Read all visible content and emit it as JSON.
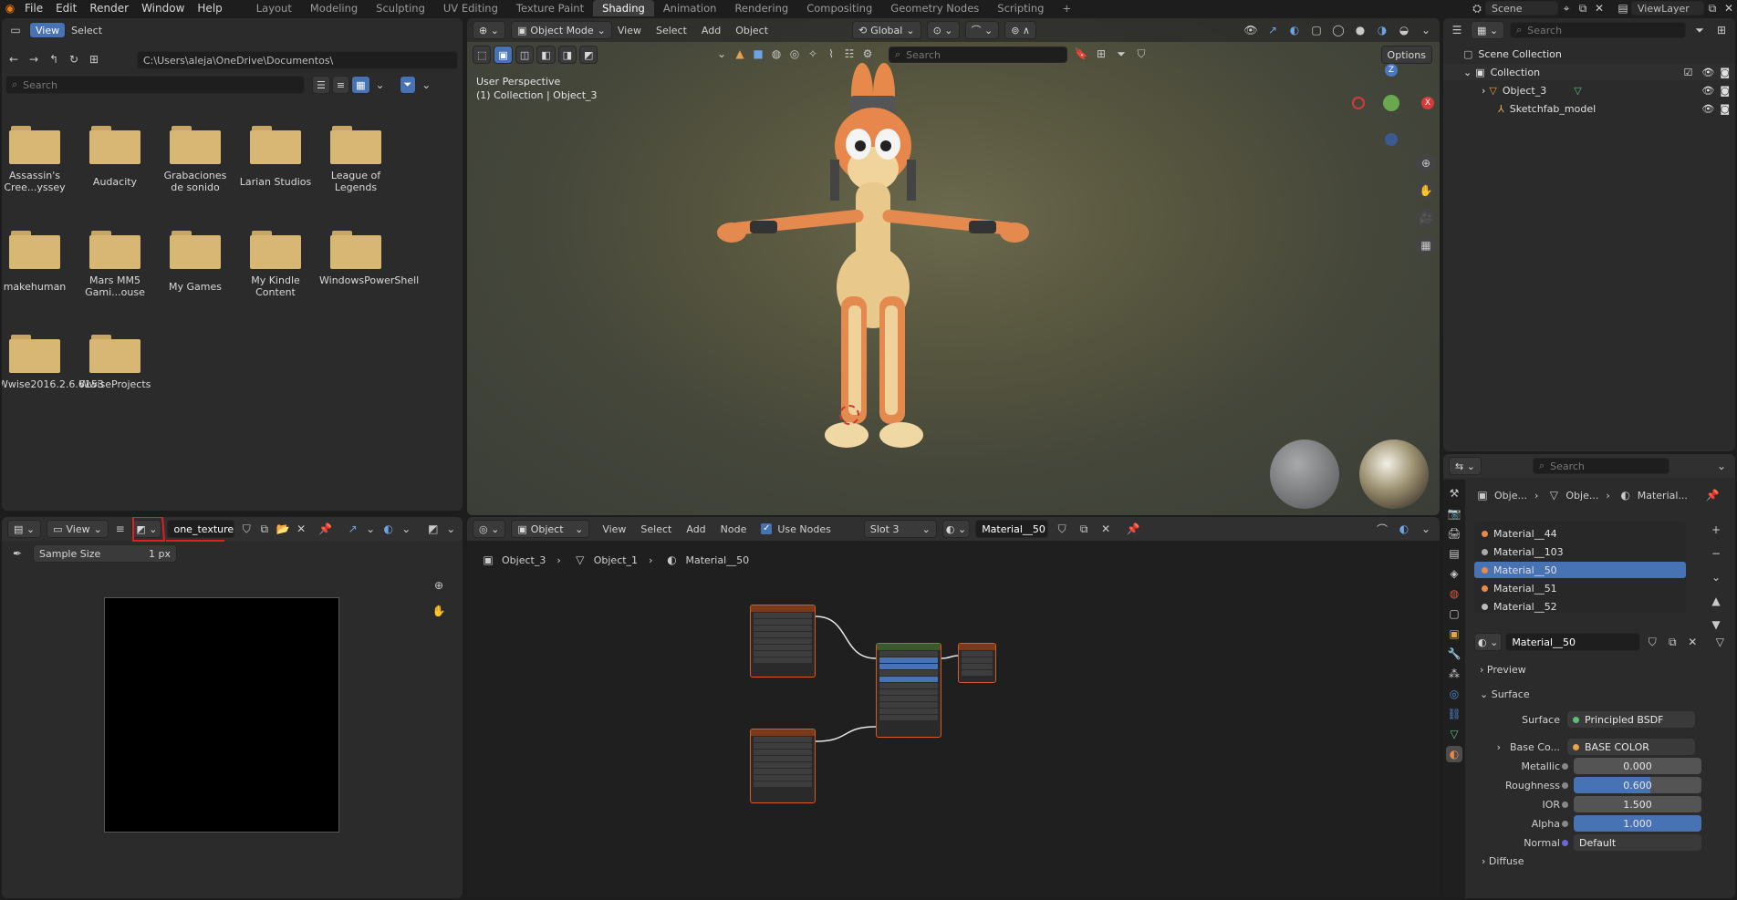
{
  "top_menu": [
    "File",
    "Edit",
    "Render",
    "Window",
    "Help"
  ],
  "workspaces": [
    "Layout",
    "Modeling",
    "Sculpting",
    "UV Editing",
    "Texture Paint",
    "Shading",
    "Animation",
    "Rendering",
    "Compositing",
    "Geometry Nodes",
    "Scripting",
    "+"
  ],
  "active_workspace": "Shading",
  "scene": "Scene",
  "view_layer": "ViewLayer",
  "file_browser": {
    "view": "View",
    "select": "Select",
    "path": "C:\\Users\\aleja\\OneDrive\\Documentos\\",
    "search_placeholder": "Search",
    "folders": [
      "Assassin's Cree...yssey",
      "Audacity",
      "Grabaciones de sonido",
      "Larian Studios",
      "League of Legends",
      "makehuman",
      "Mars MM5 Gami...ouse",
      "My Games",
      "My Kindle Content",
      "WindowsPowerShell",
      "Wwise2016.2.6.6153",
      "WwiseProjects"
    ]
  },
  "viewport": {
    "mode": "Object Mode",
    "menu": [
      "View",
      "Select",
      "Add",
      "Object"
    ],
    "transform": "Global",
    "search_placeholder": "Search",
    "options": "Options",
    "overlay_title": "User Perspective",
    "overlay_sub": "(1) Collection | Object_3"
  },
  "outliner": {
    "search_placeholder": "Search",
    "items": [
      "Scene Collection",
      "Collection",
      "Object_3",
      "Sketchfab_model"
    ]
  },
  "image_editor": {
    "view": "View",
    "image_name": "one_texture",
    "sample_label": "Sample Size",
    "sample_value": "1 px"
  },
  "node_editor": {
    "object": "Object",
    "menu": [
      "View",
      "Select",
      "Add",
      "Node"
    ],
    "use_nodes": "Use Nodes",
    "slot": "Slot 3",
    "material": "Material__50",
    "breadcrumb": [
      "Object_3",
      "Object_1",
      "Material__50"
    ]
  },
  "properties": {
    "search_placeholder": "Search",
    "breadcrumb": [
      "Obje...",
      "Obje...",
      "Material..."
    ],
    "materials": [
      "Material__44",
      "Material__103",
      "Material__50",
      "Material__51",
      "Material__52"
    ],
    "selected_material": "Material__50",
    "material_name": "Material__50",
    "preview": "Preview",
    "surface_section": "Surface",
    "surface_label": "Surface",
    "surface_value": "Principled BSDF",
    "base_color_label": "Base Co...",
    "base_color_value": "BASE COLOR",
    "metallic_label": "Metallic",
    "metallic_value": "0.000",
    "roughness_label": "Roughness",
    "roughness_value": "0.600",
    "ior_label": "IOR",
    "ior_value": "1.500",
    "alpha_label": "Alpha",
    "alpha_value": "1.000",
    "normal_label": "Normal",
    "normal_value": "Default",
    "diffuse": "Diffuse"
  },
  "colors": {
    "accent": "#4772b3",
    "node_border": "#d85a1f",
    "annotation": "#e0201c"
  }
}
